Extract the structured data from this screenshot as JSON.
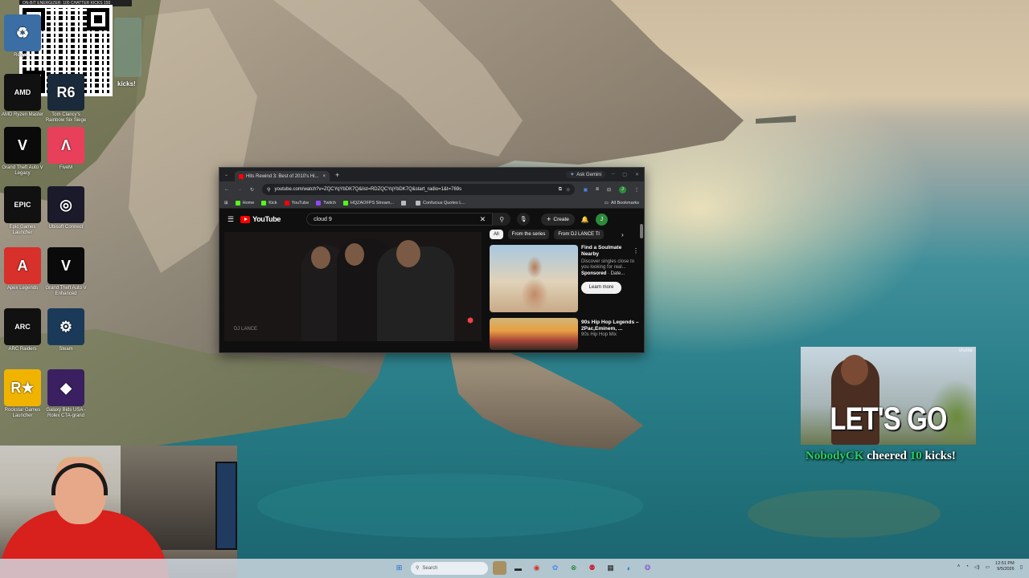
{
  "overlay_topbar": "ON-BIT ENERGIZER: 100 CHATTER KICKS   150",
  "desktop_icons": [
    {
      "label": "Recyc...",
      "color": "#3a6ea5",
      "glyph": "♻"
    },
    {
      "label": "AMD Ryzen Master",
      "color": "#111111",
      "glyph": "AMD"
    },
    {
      "label": "Tom Clancy's Rainbow Six Siege",
      "color": "#1a2a3a",
      "glyph": "R6"
    },
    {
      "label": "Grand Theft Auto V Legacy",
      "color": "#0a0a0a",
      "glyph": "V"
    },
    {
      "label": "FiveM",
      "color": "#e8405a",
      "glyph": "Λ"
    },
    {
      "label": "Epic Games Launcher",
      "color": "#111111",
      "glyph": "EPIC"
    },
    {
      "label": "Ubisoft Connect",
      "color": "#1a1a2a",
      "glyph": "◎"
    },
    {
      "label": "Apex Legends",
      "color": "#d8302a",
      "glyph": "A"
    },
    {
      "label": "Grand Theft Auto V Enhanced",
      "color": "#0a0a0a",
      "glyph": "V"
    },
    {
      "label": "ARC Raiders",
      "color": "#111111",
      "glyph": "ARC"
    },
    {
      "label": "Steam",
      "color": "#1b3a5a",
      "glyph": "⚙"
    },
    {
      "label": "Rockstar Games Launcher",
      "color": "#f0b400",
      "glyph": "R★"
    },
    {
      "label": "Galaxy Bids USA - Rolex CTA-grand",
      "color": "#3a2060",
      "glyph": "◆"
    }
  ],
  "overlay_kicks": "kicks!",
  "browser": {
    "tab_title": "Hits Rewind 3: Best of 2010's Hi...",
    "tab_close": "×",
    "new_tab": "+",
    "ask_gemini": "Ask Gemini",
    "url": "youtube.com/watch?v=ZQCYqYbDK7Q&list=RDZQCYqYbDK7Q&start_radio=1&t=769s",
    "avatar_letter": "J",
    "bookmarks": [
      {
        "label": "Home",
        "color": "#53fc18"
      },
      {
        "label": "Kick",
        "color": "#53fc18"
      },
      {
        "label": "YouTube",
        "color": "#ff0000"
      },
      {
        "label": "Twitch",
        "color": "#9146ff"
      },
      {
        "label": "HQZAOFPS Stream...",
        "color": "#53fc18"
      },
      {
        "label": "",
        "color": "#bbbbbb"
      },
      {
        "label": "Confucius Quotes L...",
        "color": "#bbbbbb"
      }
    ],
    "all_bookmarks": "All Bookmarks"
  },
  "youtube": {
    "logo": "YouTube",
    "search_value": "cloud 9",
    "create_label": "Create",
    "account_letter": "J",
    "video_watermark": "DJ LANCE",
    "chips": [
      "All",
      "From the series",
      "From DJ LANCE TI"
    ],
    "ad": {
      "title": "Find a Soulmate Nearby",
      "description": "Discover singles close to you looking for real...",
      "sponsored": "Sponsored",
      "domain": "· Date...",
      "cta": "Learn more"
    },
    "related": {
      "title": "90s Hip Hop Legends – 2Pac,Eminem, ...",
      "channel": "90s Hip Hop Mix"
    }
  },
  "alert": {
    "brand": "shuttle",
    "headline": "LET'S GO",
    "user": "NobodyCK",
    "cheered": " cheered ",
    "amount": "10",
    "kicks": " kicks!"
  },
  "taskbar": {
    "search_placeholder": "Search",
    "time": "12:51 PM",
    "date": "9/5/2026"
  }
}
